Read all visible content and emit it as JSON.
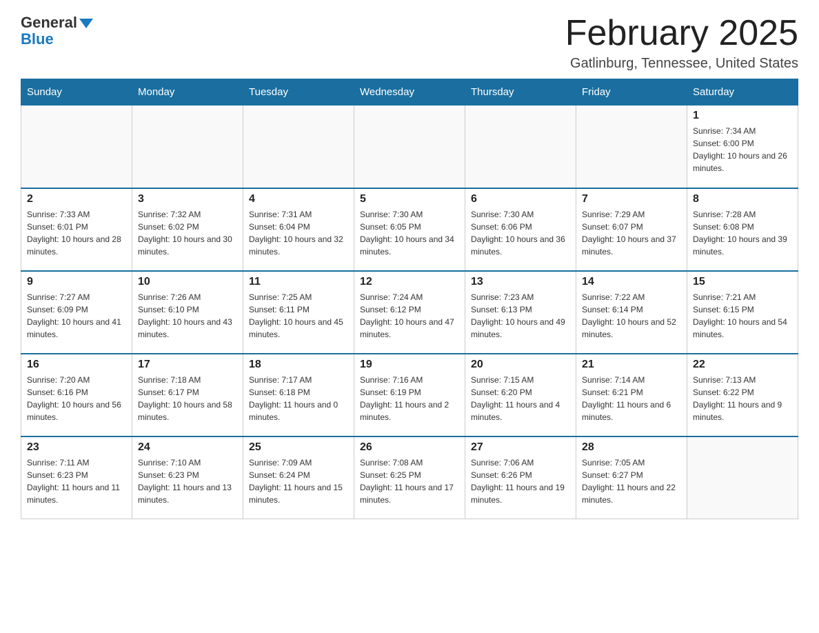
{
  "logo": {
    "general": "General",
    "blue": "Blue"
  },
  "title": "February 2025",
  "location": "Gatlinburg, Tennessee, United States",
  "weekdays": [
    "Sunday",
    "Monday",
    "Tuesday",
    "Wednesday",
    "Thursday",
    "Friday",
    "Saturday"
  ],
  "weeks": [
    [
      {
        "day": "",
        "info": ""
      },
      {
        "day": "",
        "info": ""
      },
      {
        "day": "",
        "info": ""
      },
      {
        "day": "",
        "info": ""
      },
      {
        "day": "",
        "info": ""
      },
      {
        "day": "",
        "info": ""
      },
      {
        "day": "1",
        "info": "Sunrise: 7:34 AM\nSunset: 6:00 PM\nDaylight: 10 hours and 26 minutes."
      }
    ],
    [
      {
        "day": "2",
        "info": "Sunrise: 7:33 AM\nSunset: 6:01 PM\nDaylight: 10 hours and 28 minutes."
      },
      {
        "day": "3",
        "info": "Sunrise: 7:32 AM\nSunset: 6:02 PM\nDaylight: 10 hours and 30 minutes."
      },
      {
        "day": "4",
        "info": "Sunrise: 7:31 AM\nSunset: 6:04 PM\nDaylight: 10 hours and 32 minutes."
      },
      {
        "day": "5",
        "info": "Sunrise: 7:30 AM\nSunset: 6:05 PM\nDaylight: 10 hours and 34 minutes."
      },
      {
        "day": "6",
        "info": "Sunrise: 7:30 AM\nSunset: 6:06 PM\nDaylight: 10 hours and 36 minutes."
      },
      {
        "day": "7",
        "info": "Sunrise: 7:29 AM\nSunset: 6:07 PM\nDaylight: 10 hours and 37 minutes."
      },
      {
        "day": "8",
        "info": "Sunrise: 7:28 AM\nSunset: 6:08 PM\nDaylight: 10 hours and 39 minutes."
      }
    ],
    [
      {
        "day": "9",
        "info": "Sunrise: 7:27 AM\nSunset: 6:09 PM\nDaylight: 10 hours and 41 minutes."
      },
      {
        "day": "10",
        "info": "Sunrise: 7:26 AM\nSunset: 6:10 PM\nDaylight: 10 hours and 43 minutes."
      },
      {
        "day": "11",
        "info": "Sunrise: 7:25 AM\nSunset: 6:11 PM\nDaylight: 10 hours and 45 minutes."
      },
      {
        "day": "12",
        "info": "Sunrise: 7:24 AM\nSunset: 6:12 PM\nDaylight: 10 hours and 47 minutes."
      },
      {
        "day": "13",
        "info": "Sunrise: 7:23 AM\nSunset: 6:13 PM\nDaylight: 10 hours and 49 minutes."
      },
      {
        "day": "14",
        "info": "Sunrise: 7:22 AM\nSunset: 6:14 PM\nDaylight: 10 hours and 52 minutes."
      },
      {
        "day": "15",
        "info": "Sunrise: 7:21 AM\nSunset: 6:15 PM\nDaylight: 10 hours and 54 minutes."
      }
    ],
    [
      {
        "day": "16",
        "info": "Sunrise: 7:20 AM\nSunset: 6:16 PM\nDaylight: 10 hours and 56 minutes."
      },
      {
        "day": "17",
        "info": "Sunrise: 7:18 AM\nSunset: 6:17 PM\nDaylight: 10 hours and 58 minutes."
      },
      {
        "day": "18",
        "info": "Sunrise: 7:17 AM\nSunset: 6:18 PM\nDaylight: 11 hours and 0 minutes."
      },
      {
        "day": "19",
        "info": "Sunrise: 7:16 AM\nSunset: 6:19 PM\nDaylight: 11 hours and 2 minutes."
      },
      {
        "day": "20",
        "info": "Sunrise: 7:15 AM\nSunset: 6:20 PM\nDaylight: 11 hours and 4 minutes."
      },
      {
        "day": "21",
        "info": "Sunrise: 7:14 AM\nSunset: 6:21 PM\nDaylight: 11 hours and 6 minutes."
      },
      {
        "day": "22",
        "info": "Sunrise: 7:13 AM\nSunset: 6:22 PM\nDaylight: 11 hours and 9 minutes."
      }
    ],
    [
      {
        "day": "23",
        "info": "Sunrise: 7:11 AM\nSunset: 6:23 PM\nDaylight: 11 hours and 11 minutes."
      },
      {
        "day": "24",
        "info": "Sunrise: 7:10 AM\nSunset: 6:23 PM\nDaylight: 11 hours and 13 minutes."
      },
      {
        "day": "25",
        "info": "Sunrise: 7:09 AM\nSunset: 6:24 PM\nDaylight: 11 hours and 15 minutes."
      },
      {
        "day": "26",
        "info": "Sunrise: 7:08 AM\nSunset: 6:25 PM\nDaylight: 11 hours and 17 minutes."
      },
      {
        "day": "27",
        "info": "Sunrise: 7:06 AM\nSunset: 6:26 PM\nDaylight: 11 hours and 19 minutes."
      },
      {
        "day": "28",
        "info": "Sunrise: 7:05 AM\nSunset: 6:27 PM\nDaylight: 11 hours and 22 minutes."
      },
      {
        "day": "",
        "info": ""
      }
    ]
  ]
}
